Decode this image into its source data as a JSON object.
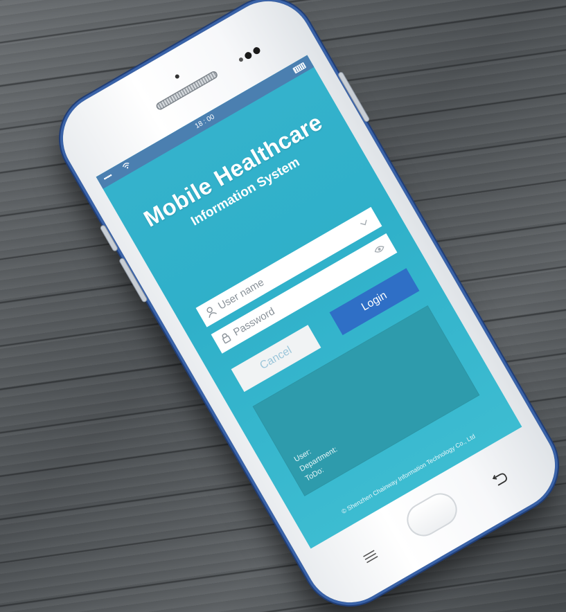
{
  "status_bar": {
    "signal": "•••••",
    "time": "18 : 00"
  },
  "app": {
    "title_line1": "Mobile Healthcare",
    "title_line2": "Information System"
  },
  "form": {
    "username_placeholder": "User name",
    "password_placeholder": "Password",
    "cancel_label": "Cancel",
    "login_label": "Login"
  },
  "info_panel": {
    "user_label": "User:",
    "department_label": "Department:",
    "todo_label": "ToDo:"
  },
  "footer": {
    "copyright": "© Shenzhen Chainway Information Technology Co., Ltd"
  },
  "icons": {
    "username": "user-icon",
    "password": "lock-icon",
    "dropdown": "chevron-down-icon",
    "show_password": "eye-icon",
    "menu": "menu-icon",
    "back": "back-icon",
    "wifi": "wifi-icon",
    "battery": "battery-icon"
  },
  "colors": {
    "screen_bg": "#35b2cc",
    "status_bar": "#4b7fb0",
    "login_button": "#2f6fc6",
    "info_panel": "#2e9bac",
    "phone_frame": "#3a63a8"
  }
}
